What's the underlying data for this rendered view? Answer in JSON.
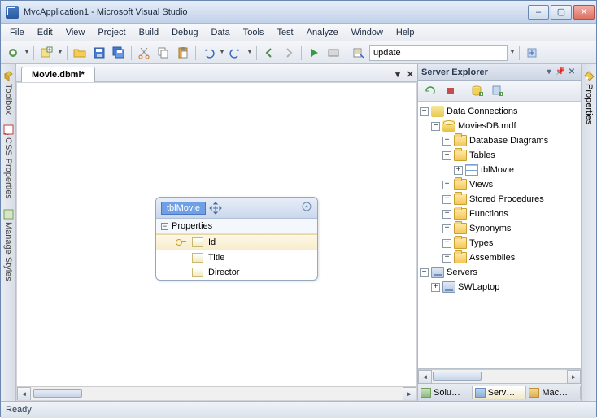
{
  "window": {
    "title": "MvcApplication1 - Microsoft Visual Studio"
  },
  "menu": [
    "File",
    "Edit",
    "View",
    "Project",
    "Build",
    "Debug",
    "Data",
    "Tools",
    "Test",
    "Analyze",
    "Window",
    "Help"
  ],
  "toolbar": {
    "config_value": "update"
  },
  "document": {
    "tab_title": "Movie.dbml*"
  },
  "entity": {
    "name": "tblMovie",
    "section": "Properties",
    "fields": [
      {
        "name": "Id",
        "is_key": true
      },
      {
        "name": "Title",
        "is_key": false
      },
      {
        "name": "Director",
        "is_key": false
      }
    ]
  },
  "server_explorer": {
    "title": "Server Explorer",
    "tree": {
      "data_connections": "Data Connections",
      "db": "MoviesDB.mdf",
      "nodes": {
        "diagrams": "Database Diagrams",
        "tables": "Tables",
        "table_item": "tblMovie",
        "views": "Views",
        "sprocs": "Stored Procedures",
        "functions": "Functions",
        "synonyms": "Synonyms",
        "types": "Types",
        "assemblies": "Assemblies"
      },
      "servers": "Servers",
      "server_item": "SWLaptop"
    },
    "bottom_tabs": {
      "solution": "Solu…",
      "server": "Serv…",
      "macro": "Mac…"
    }
  },
  "left_rail": {
    "toolbox": "Toolbox",
    "css": "CSS Properties",
    "styles": "Manage Styles"
  },
  "right_rail": {
    "properties": "Properties"
  },
  "status": {
    "text": "Ready"
  }
}
